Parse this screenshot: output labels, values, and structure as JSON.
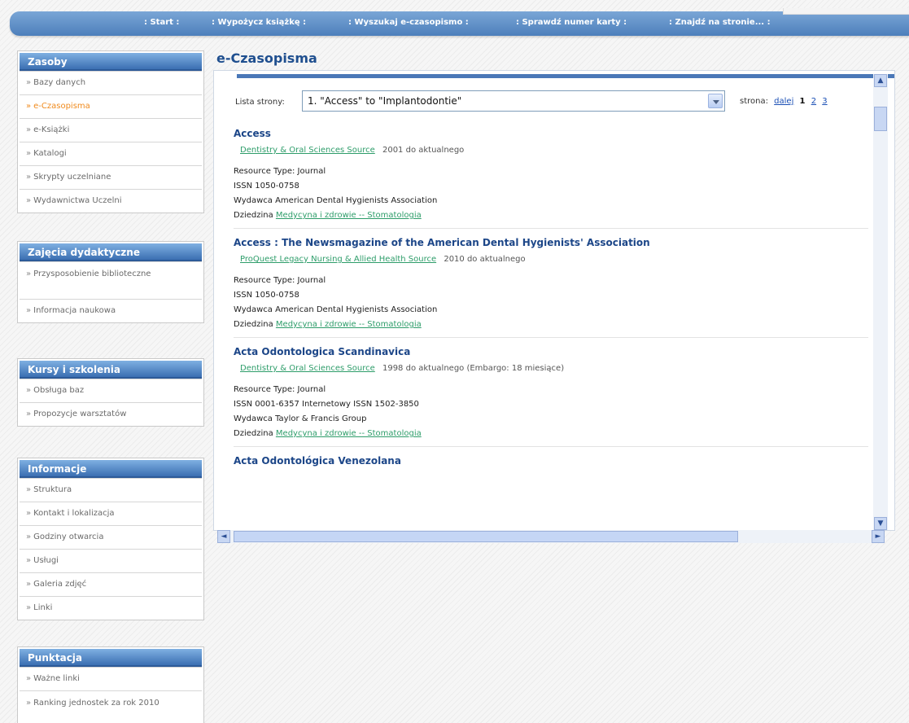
{
  "nav": {
    "items": [
      ": Start :",
      ": Wypożycz książkę :",
      ": Wyszukaj e-czasopismo :",
      ": Sprawdź numer karty :",
      ": Znajdź na stronie... :"
    ]
  },
  "sidebar": {
    "zasoby": {
      "title": "Zasoby",
      "items": [
        "Bazy danych",
        "e-Czasopisma",
        "e-Książki",
        "Katalogi",
        "Skrypty uczelniane",
        "Wydawnictwa Uczelni"
      ]
    },
    "zajecia": {
      "title": "Zajęcia dydaktyczne",
      "items": [
        "Przysposobienie biblioteczne",
        "Informacja naukowa"
      ]
    },
    "kursy": {
      "title": "Kursy i szkolenia",
      "items": [
        "Obsługa baz",
        "Propozycje warsztatów"
      ]
    },
    "informacje": {
      "title": "Informacje",
      "items": [
        "Struktura",
        "Kontakt i lokalizacja",
        "Godziny otwarcia",
        "Usługi",
        "Galeria zdjęć",
        "Linki"
      ]
    },
    "punktacja": {
      "title": "Punktacja",
      "items": [
        "Ważne linki",
        "Ranking jednostek za rok 2010"
      ]
    },
    "arrow": "»"
  },
  "main": {
    "title": "e-Czasopisma",
    "list_label": "Lista strony:",
    "select_value": "1. \"Access\" to \"Implantodontie\"",
    "pager": {
      "label": "strona:",
      "next": "dalej",
      "current": "1",
      "pages": [
        "2",
        "3"
      ]
    },
    "entries": [
      {
        "title": "Access",
        "source": "Dentistry & Oral Sciences Source",
        "coverage": "2001 do aktualnego",
        "type": "Resource Type: Journal",
        "issn": "ISSN 1050-0758",
        "publisher": "Wydawca American Dental Hygienists Association",
        "field_label": "Dziedzina",
        "field": "Medycyna i zdrowie -- Stomatologia"
      },
      {
        "title": "Access : The Newsmagazine of the American Dental Hygienists' Association",
        "source": "ProQuest Legacy Nursing & Allied Health Source",
        "coverage": "2010 do aktualnego",
        "type": "Resource Type: Journal",
        "issn": "ISSN 1050-0758",
        "publisher": "Wydawca American Dental Hygienists Association",
        "field_label": "Dziedzina",
        "field": "Medycyna i zdrowie -- Stomatologia"
      },
      {
        "title": "Acta Odontologica Scandinavica",
        "source": "Dentistry & Oral Sciences Source",
        "coverage": "1998 do aktualnego (Embargo: 18 miesiące)",
        "type": "Resource Type: Journal",
        "issn": "ISSN 0001-6357 Internetowy ISSN 1502-3850",
        "publisher": "Wydawca Taylor & Francis Group",
        "field_label": "Dziedzina",
        "field": "Medycyna i zdrowie -- Stomatologia"
      },
      {
        "title": "Acta Odontológica Venezolana"
      }
    ]
  },
  "scroll": {
    "up": "▲",
    "down": "▼",
    "left": "◄",
    "right": "►"
  }
}
